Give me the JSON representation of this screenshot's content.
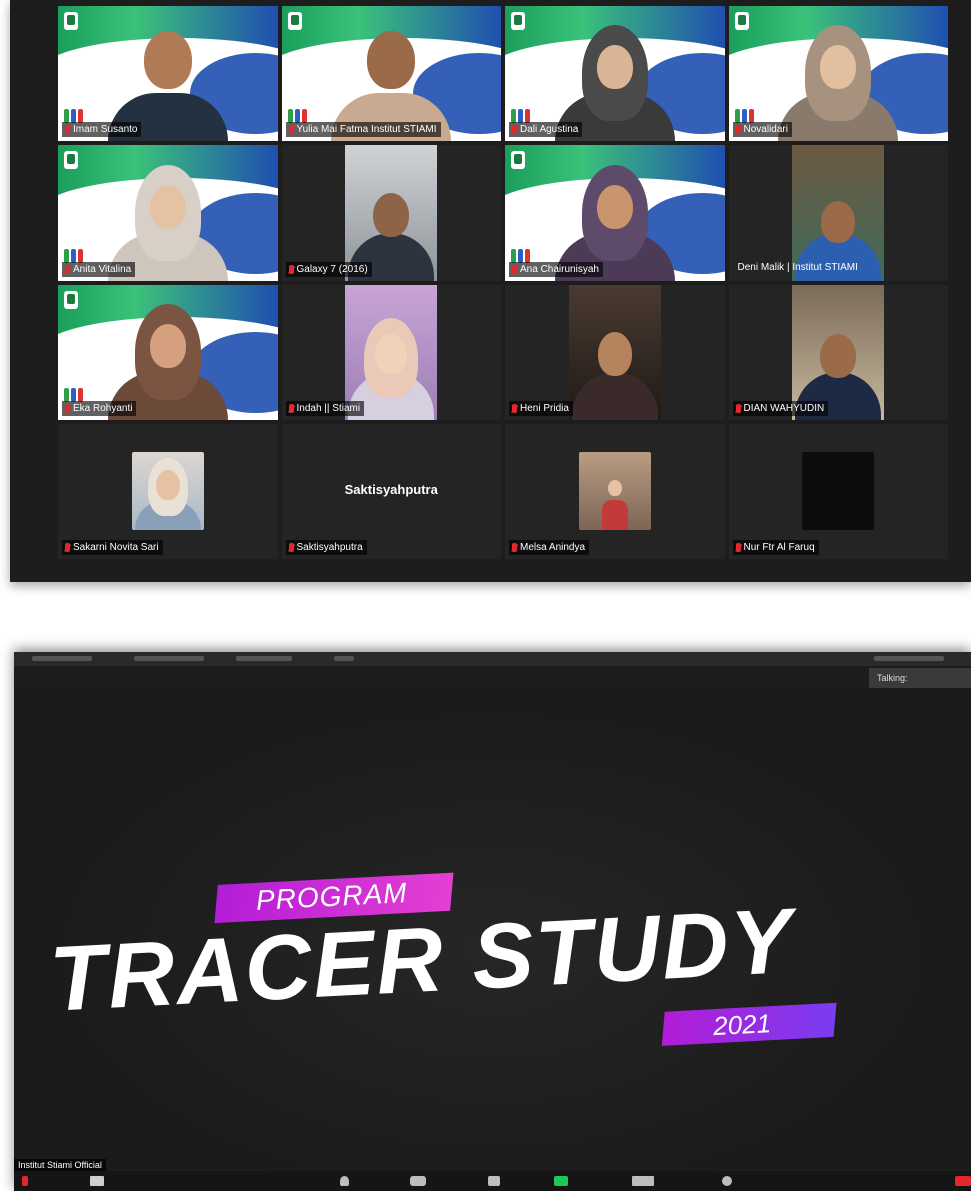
{
  "gallery": {
    "participants": [
      {
        "name": "Imam Susanto"
      },
      {
        "name": "Yulia Mai Fatma Institut STIAMI"
      },
      {
        "name": "Dali Agustina"
      },
      {
        "name": "Novalidari"
      },
      {
        "name": "Anita Vitalina"
      },
      {
        "name": "Galaxy 7 (2016)"
      },
      {
        "name": "Ana Chairunisyah"
      },
      {
        "name": "Deni Malik | Institut STIAMI"
      },
      {
        "name": "Eka Rohyanti"
      },
      {
        "name": "Indah || Stiami"
      },
      {
        "name": "Heni Pridia"
      },
      {
        "name": "DIAN WAHYUDIN"
      },
      {
        "name": "Sakarni Novita Sari"
      },
      {
        "name": "Saktisyahputra",
        "center_label": "Saktisyahputra"
      },
      {
        "name": "Melsa Anindya"
      },
      {
        "name": "Nur Ftr Al Faruq"
      }
    ]
  },
  "share": {
    "talking_label": "Talking:",
    "slide": {
      "program_label": "PROGRAM",
      "title": "TRACER STUDY",
      "year": "2021"
    },
    "host_label": "Institut Stiami Official"
  }
}
